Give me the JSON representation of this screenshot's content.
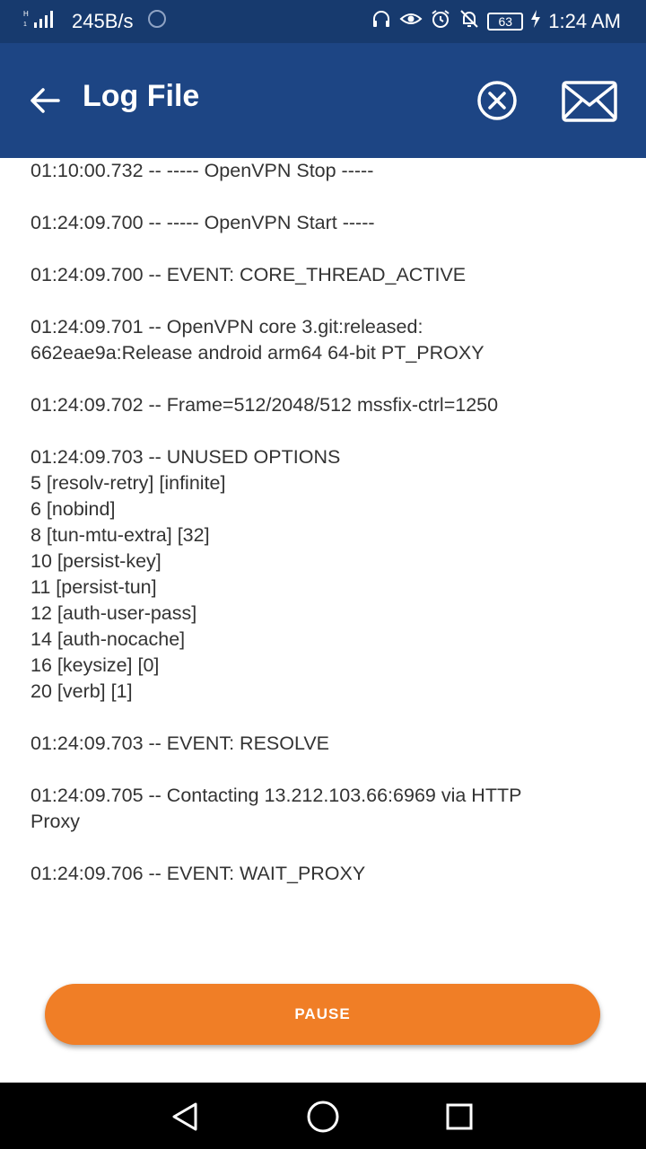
{
  "status_bar": {
    "net_speed": "245B/s",
    "battery": "63",
    "time": "1:24 AM",
    "icons": [
      "signal-icon",
      "sync-icon",
      "headphones-icon",
      "eye-icon",
      "alarm-icon",
      "mute-notifications-icon",
      "battery-icon",
      "charging-icon"
    ]
  },
  "toolbar": {
    "title": "Log File",
    "back_icon": "arrow-left-icon",
    "close_icon": "close-circle-icon",
    "mail_icon": "mail-icon",
    "background": "#1d4584"
  },
  "log": {
    "text": "01:10:00.732 -- ----- OpenVPN Stop -----\n\n01:24:09.700 -- ----- OpenVPN Start -----\n\n01:24:09.700 -- EVENT: CORE_THREAD_ACTIVE\n\n01:24:09.701 -- OpenVPN core 3.git:released:\n662eae9a:Release android arm64 64-bit PT_PROXY\n\n01:24:09.702 -- Frame=512/2048/512 mssfix-ctrl=1250\n\n01:24:09.703 -- UNUSED OPTIONS\n5 [resolv-retry] [infinite]\n6 [nobind]\n8 [tun-mtu-extra] [32]\n10 [persist-key]\n11 [persist-tun]\n12 [auth-user-pass]\n14 [auth-nocache]\n16 [keysize] [0]\n20 [verb] [1]\n\n01:24:09.703 -- EVENT: RESOLVE\n\n01:24:09.705 -- Contacting 13.212.103.66:6969 via HTTP\nProxy\n\n01:24:09.706 -- EVENT: WAIT_PROXY"
  },
  "pause_button": {
    "label": "PAUSE",
    "color": "#f07e26"
  },
  "nav_bar": {
    "icons": [
      "back-triangle-icon",
      "home-circle-icon",
      "recents-square-icon"
    ]
  }
}
